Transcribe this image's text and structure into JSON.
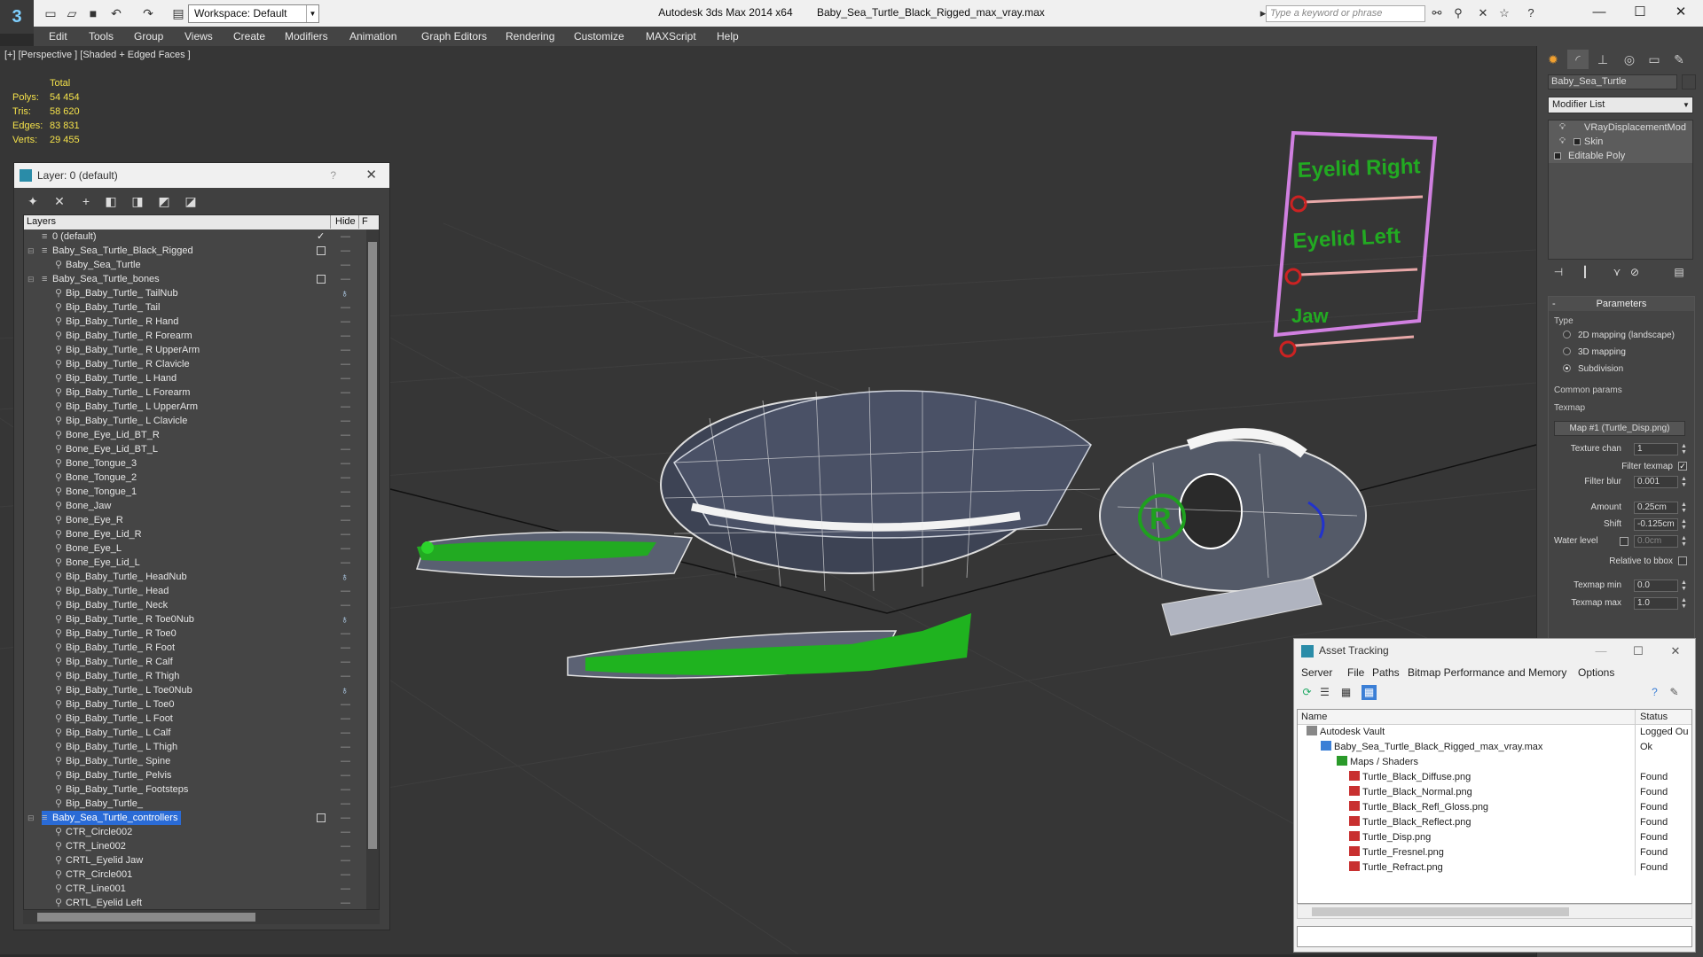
{
  "title_bar": {
    "app": "Autodesk 3ds Max  2014 x64",
    "file": "Baby_Sea_Turtle_Black_Rigged_max_vray.max",
    "workspace": "Workspace: Default",
    "search_placeholder": "Type a keyword or phrase"
  },
  "menu": [
    "Edit",
    "Tools",
    "Group",
    "Views",
    "Create",
    "Modifiers",
    "Animation",
    "Graph Editors",
    "Rendering",
    "Customize",
    "MAXScript",
    "Help"
  ],
  "viewport": {
    "label": "[+] [Perspective ] [Shaded + Edged Faces ]",
    "stats": {
      "header": "Total",
      "rows": [
        {
          "label": "Polys:",
          "value": "54 454"
        },
        {
          "label": "Tris:",
          "value": "58 620"
        },
        {
          "label": "Edges:",
          "value": "83 831"
        },
        {
          "label": "Verts:",
          "value": "29 455"
        }
      ]
    },
    "gizmo_labels": [
      "Eyelid Right",
      "Eyelid Left",
      "Jaw"
    ]
  },
  "layer_panel": {
    "title": "Layer: 0 (default)",
    "help": "?",
    "columns": {
      "layers": "Layers",
      "hide": "Hide",
      "freeze": "F"
    },
    "rows": [
      {
        "name": "0 (default)",
        "kind": "layer",
        "mark": "tick"
      },
      {
        "name": "Baby_Sea_Turtle_Black_Rigged",
        "kind": "layer",
        "mark": "box",
        "exp": "−"
      },
      {
        "name": "Baby_Sea_Turtle",
        "kind": "child"
      },
      {
        "name": "Baby_Sea_Turtle_bones",
        "kind": "layer",
        "mark": "box",
        "exp": "−"
      },
      {
        "name": "Bip_Baby_Turtle_ TailNub",
        "kind": "child",
        "bulb": true
      },
      {
        "name": "Bip_Baby_Turtle_ Tail",
        "kind": "child"
      },
      {
        "name": "Bip_Baby_Turtle_ R Hand",
        "kind": "child"
      },
      {
        "name": "Bip_Baby_Turtle_ R Forearm",
        "kind": "child"
      },
      {
        "name": "Bip_Baby_Turtle_ R UpperArm",
        "kind": "child"
      },
      {
        "name": "Bip_Baby_Turtle_ R Clavicle",
        "kind": "child"
      },
      {
        "name": "Bip_Baby_Turtle_ L Hand",
        "kind": "child"
      },
      {
        "name": "Bip_Baby_Turtle_ L Forearm",
        "kind": "child"
      },
      {
        "name": "Bip_Baby_Turtle_ L UpperArm",
        "kind": "child"
      },
      {
        "name": "Bip_Baby_Turtle_ L Clavicle",
        "kind": "child"
      },
      {
        "name": "Bone_Eye_Lid_BT_R",
        "kind": "child"
      },
      {
        "name": "Bone_Eye_Lid_BT_L",
        "kind": "child"
      },
      {
        "name": "Bone_Tongue_3",
        "kind": "child"
      },
      {
        "name": "Bone_Tongue_2",
        "kind": "child"
      },
      {
        "name": "Bone_Tongue_1",
        "kind": "child"
      },
      {
        "name": "Bone_Jaw",
        "kind": "child"
      },
      {
        "name": "Bone_Eye_R",
        "kind": "child"
      },
      {
        "name": "Bone_Eye_Lid_R",
        "kind": "child"
      },
      {
        "name": "Bone_Eye_L",
        "kind": "child"
      },
      {
        "name": "Bone_Eye_Lid_L",
        "kind": "child"
      },
      {
        "name": "Bip_Baby_Turtle_ HeadNub",
        "kind": "child",
        "bulb": true
      },
      {
        "name": "Bip_Baby_Turtle_ Head",
        "kind": "child"
      },
      {
        "name": "Bip_Baby_Turtle_ Neck",
        "kind": "child"
      },
      {
        "name": "Bip_Baby_Turtle_ R Toe0Nub",
        "kind": "child",
        "bulb": true
      },
      {
        "name": "Bip_Baby_Turtle_ R Toe0",
        "kind": "child"
      },
      {
        "name": "Bip_Baby_Turtle_ R Foot",
        "kind": "child"
      },
      {
        "name": "Bip_Baby_Turtle_ R Calf",
        "kind": "child"
      },
      {
        "name": "Bip_Baby_Turtle_ R Thigh",
        "kind": "child"
      },
      {
        "name": "Bip_Baby_Turtle_ L Toe0Nub",
        "kind": "child",
        "bulb": true
      },
      {
        "name": "Bip_Baby_Turtle_ L Toe0",
        "kind": "child"
      },
      {
        "name": "Bip_Baby_Turtle_ L Foot",
        "kind": "child"
      },
      {
        "name": "Bip_Baby_Turtle_ L Calf",
        "kind": "child"
      },
      {
        "name": "Bip_Baby_Turtle_ L Thigh",
        "kind": "child"
      },
      {
        "name": "Bip_Baby_Turtle_ Spine",
        "kind": "child"
      },
      {
        "name": "Bip_Baby_Turtle_ Pelvis",
        "kind": "child"
      },
      {
        "name": "Bip_Baby_Turtle_ Footsteps",
        "kind": "child"
      },
      {
        "name": "Bip_Baby_Turtle_",
        "kind": "child"
      },
      {
        "name": "Baby_Sea_Turtle_controllers",
        "kind": "layer",
        "mark": "box",
        "exp": "−",
        "selected": true
      },
      {
        "name": "CTR_Circle002",
        "kind": "child"
      },
      {
        "name": "CTR_Line002",
        "kind": "child"
      },
      {
        "name": "CRTL_Eyelid Jaw",
        "kind": "child"
      },
      {
        "name": "CTR_Circle001",
        "kind": "child"
      },
      {
        "name": "CTR_Line001",
        "kind": "child"
      },
      {
        "name": "CRTL_Eyelid Left",
        "kind": "child"
      }
    ]
  },
  "command_panel": {
    "object_name": "Baby_Sea_Turtle",
    "modifier_list": "Modifier List",
    "stack": [
      {
        "label": "VRayDisplacementMod",
        "bulb": true,
        "box": false
      },
      {
        "label": "Skin",
        "bulb": true,
        "box": true
      },
      {
        "label": "Editable Poly",
        "bulb": false,
        "box": true,
        "base": true
      }
    ],
    "parameters": {
      "title": "Parameters",
      "type_label": "Type",
      "types": [
        {
          "label": "2D mapping (landscape)",
          "on": false
        },
        {
          "label": "3D mapping",
          "on": false
        },
        {
          "label": "Subdivision",
          "on": true
        }
      ],
      "common_label": "Common params",
      "texmap_label": "Texmap",
      "texmap_value": "Map #1 (Turtle_Disp.png)",
      "texture_chan_label": "Texture chan",
      "texture_chan": "1",
      "filter_texmap_label": "Filter texmap",
      "filter_texmap_checkmark": "✓",
      "filter_blur_label": "Filter blur",
      "filter_blur": "0.001",
      "amount_label": "Amount",
      "amount": "0.25cm",
      "shift_label": "Shift",
      "shift": "-0.125cm",
      "water_level_label": "Water level",
      "water_level": "0.0cm",
      "relative_bbox_label": "Relative to bbox",
      "texmap_min_label": "Texmap min",
      "texmap_min": "0.0",
      "texmap_max_label": "Texmap max",
      "texmap_max": "1.0"
    }
  },
  "asset_tracking": {
    "title": "Asset Tracking",
    "menu": [
      "Server",
      "File",
      "Paths",
      "Bitmap Performance and Memory",
      "Options"
    ],
    "columns": {
      "name": "Name",
      "status": "Status"
    },
    "rows": [
      {
        "name": "Autodesk Vault",
        "status": "Logged Ou",
        "level": 0,
        "icon": "vault"
      },
      {
        "name": "Baby_Sea_Turtle_Black_Rigged_max_vray.max",
        "status": "Ok",
        "level": 1,
        "icon": "max"
      },
      {
        "name": "Maps / Shaders",
        "status": "",
        "level": 2,
        "icon": "folder"
      },
      {
        "name": "Turtle_Black_Diffuse.png",
        "status": "Found",
        "level": 3,
        "icon": "png"
      },
      {
        "name": "Turtle_Black_Normal.png",
        "status": "Found",
        "level": 3,
        "icon": "png"
      },
      {
        "name": "Turtle_Black_Refl_Gloss.png",
        "status": "Found",
        "level": 3,
        "icon": "png"
      },
      {
        "name": "Turtle_Black_Reflect.png",
        "status": "Found",
        "level": 3,
        "icon": "png"
      },
      {
        "name": "Turtle_Disp.png",
        "status": "Found",
        "level": 3,
        "icon": "png"
      },
      {
        "name": "Turtle_Fresnel.png",
        "status": "Found",
        "level": 3,
        "icon": "png"
      },
      {
        "name": "Turtle_Refract.png",
        "status": "Found",
        "level": 3,
        "icon": "png"
      }
    ]
  },
  "colors": {
    "stats": "#f4e14a",
    "controller_green": "#22aa22",
    "gizmo_frame": "#d080e0",
    "selection": "#2a6bd6"
  }
}
